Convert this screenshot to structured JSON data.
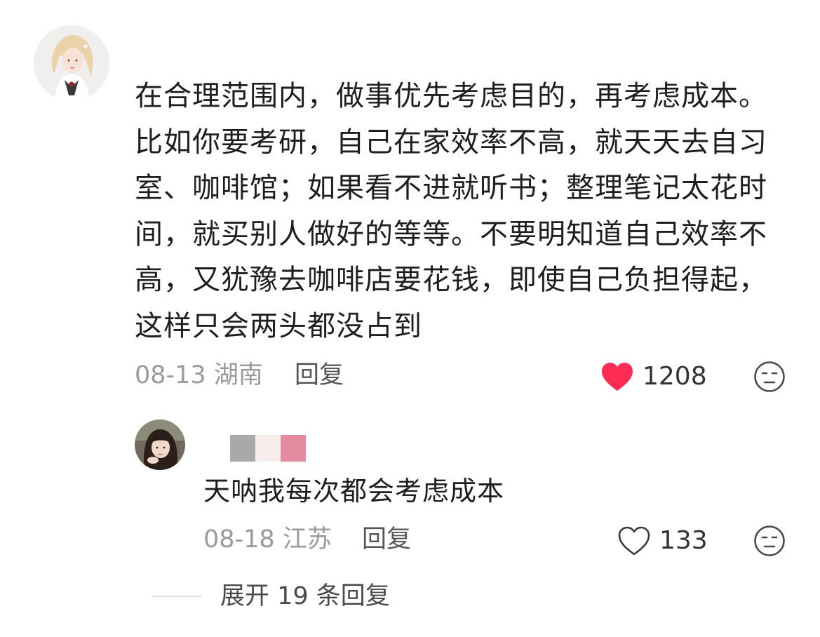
{
  "comment": {
    "text": "在合理范围内，做事优先考虑目的，再考虑成本。\n比如你要考研，自己在家效率不高，就天天去自习\n室、咖啡馆；如果看不进就听书；整理笔记太花时\n间，就买别人做好的等等。不要明知道自己效率不\n高，又犹豫去咖啡店要花钱，即使自己负担得起，\n这样只会两头都没占到",
    "date": "08-13",
    "location": "湖南",
    "reply_label": "回复",
    "like_count": "1208",
    "liked": true,
    "like_color": "#fe2c55"
  },
  "reply": {
    "text": "天呐我每次都会考虑成本",
    "date": "08-18",
    "location": "江苏",
    "reply_label": "回复",
    "like_count": "133",
    "liked": false,
    "username_mask_colors": [
      "#a9a9a9",
      "#f7eded",
      "#e48aa1"
    ]
  },
  "expand_replies": {
    "label": "展开 19 条回复"
  }
}
